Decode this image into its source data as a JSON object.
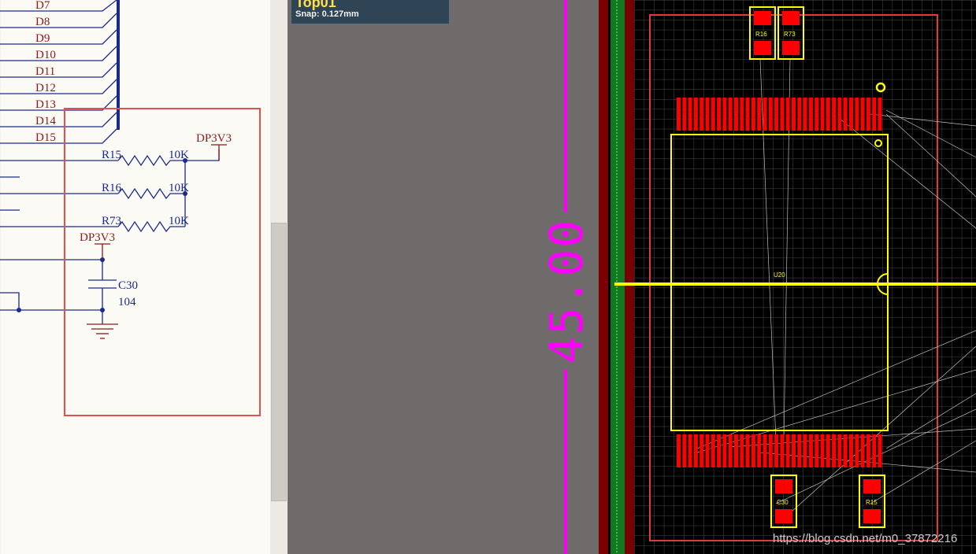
{
  "schematic": {
    "net_labels": [
      "D7",
      "D8",
      "D9",
      "D10",
      "D11",
      "D12",
      "D13",
      "D14",
      "D15"
    ],
    "resistors": [
      {
        "designator": "R15",
        "value": "10K"
      },
      {
        "designator": "R16",
        "value": "10K"
      },
      {
        "designator": "R73",
        "value": "10K"
      }
    ],
    "power_ports": [
      "DP3V3",
      "DP3V3"
    ],
    "capacitor": {
      "designator": "C30",
      "value": "104"
    },
    "colors": {
      "wire": "#1a2a8c",
      "label": "#8b1a1a",
      "bus": "#1a2a8c",
      "highlight_box": "#e05050",
      "background": "#fbfaf4"
    }
  },
  "pcb": {
    "tooltip": {
      "layer": "Top01",
      "snap": "Snap: 0.127mm"
    },
    "dimension_text": "45.00",
    "components": {
      "top_left_pad": "R16",
      "top_right_pad": "R73",
      "ic": "U20",
      "bottom_left_pad": "C30",
      "bottom_right_pad": "R15"
    },
    "colors": {
      "board_bg": "#000000",
      "grid": "#3c3c3c",
      "pad": "#ff0000",
      "silkscreen": "#ffff00",
      "keepout": "#ff00ff",
      "outline": "#e03a3a"
    }
  },
  "watermark": "https://blog.csdn.net/m0_37872216"
}
